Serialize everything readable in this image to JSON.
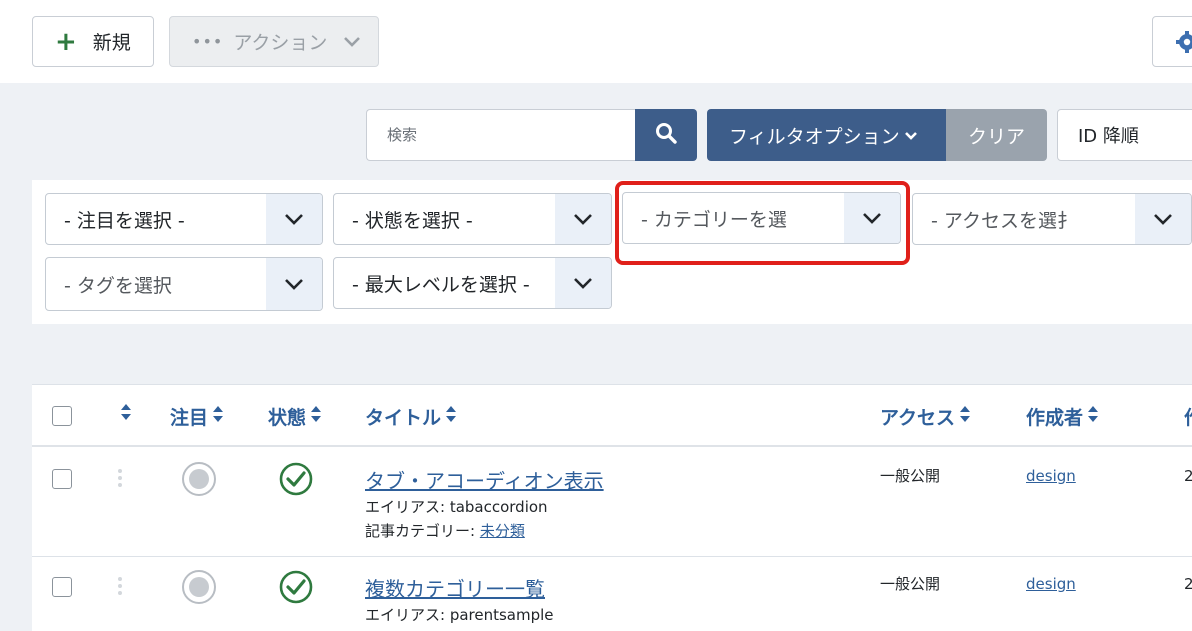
{
  "toolbar": {
    "new_label": "新規",
    "actions_label": "アクション"
  },
  "search": {
    "placeholder": "検索",
    "filter_options_label": "フィルタオプション",
    "clear_label": "クリア",
    "sort_value": "ID 降順"
  },
  "filters": {
    "featured": "- 注目を選択 -",
    "state": "- 状態を選択 -",
    "category": "- カテゴリーを選",
    "access": "- アクセスを選扌",
    "tag": "- タグを選択",
    "max_level": "- 最大レベルを選択 -"
  },
  "table": {
    "headers": {
      "featured": "注目",
      "status": "状態",
      "title": "タイトル",
      "access": "アクセス",
      "author": "作成者",
      "date": "作"
    },
    "rows": [
      {
        "title": "タブ・アコーディオン表示",
        "alias": "エイリアス: tabaccordion",
        "category_label": "記事カテゴリー: ",
        "category": "未分類",
        "access": "一般公開",
        "author": "design",
        "date": "2"
      },
      {
        "title": "複数カテゴリー一覧",
        "alias": "エイリアス: parentsample",
        "access": "一般公開",
        "author": "design",
        "date": "2"
      }
    ]
  },
  "colors": {
    "primary": "#3d5d8a",
    "clear": "#9aa3ad",
    "link": "#2e5f9a",
    "highlight": "#e0201a",
    "published": "#2f7a3f"
  }
}
